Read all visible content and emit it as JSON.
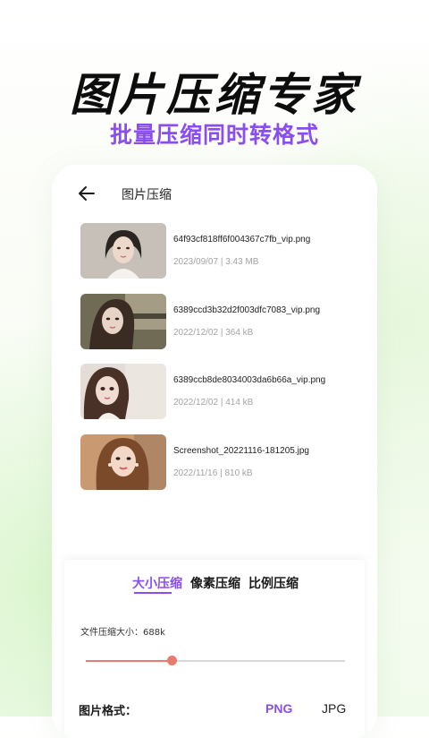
{
  "promo": {
    "title": "图片压缩专家",
    "subtitle": "批量压缩同时转格式",
    "accent_color": "#8a4df0"
  },
  "app": {
    "back_icon": "arrow-left-icon",
    "title": "图片压缩",
    "files": [
      {
        "name": "64f93cf818ff6f004367c7fb_vip.png",
        "meta": "2023/09/07 | 3.43 MB"
      },
      {
        "name": "6389ccd3b32d2f003dfc7083_vip.png",
        "meta": "2022/12/02 | 364 kB"
      },
      {
        "name": "6389ccb8de8034003da6b66a_vip.png",
        "meta": "2022/12/02 | 414 kB"
      },
      {
        "name": "Screenshot_20221116-181205.jpg",
        "meta": "2022/11/16 | 810 kB"
      }
    ],
    "panel": {
      "tabs": [
        {
          "label": "大小压缩",
          "active": true
        },
        {
          "label": "像素压缩",
          "active": false
        },
        {
          "label": "比例压缩",
          "active": false
        }
      ],
      "size_label": "文件压缩大小：688k",
      "slider_fraction": 0.33,
      "slider_color": "#e87a6e",
      "format_label": "图片格式：",
      "formats": [
        {
          "label": "PNG",
          "selected": true
        },
        {
          "label": "JPG",
          "selected": false
        }
      ]
    }
  }
}
